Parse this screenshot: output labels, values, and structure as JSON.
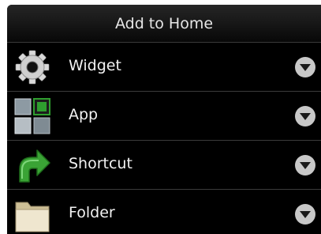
{
  "dialog": {
    "title": "Add to Home",
    "items": [
      {
        "label": "Widget",
        "icon": "gear-icon",
        "arrow": "chevron-down-icon"
      },
      {
        "label": "App",
        "icon": "app-grid-icon",
        "arrow": "chevron-down-icon"
      },
      {
        "label": "Shortcut",
        "icon": "shortcut-arrow-icon",
        "arrow": "chevron-down-icon"
      },
      {
        "label": "Folder",
        "icon": "folder-icon",
        "arrow": "chevron-down-icon"
      }
    ]
  },
  "colors": {
    "background": "#000000",
    "text": "#f2f2f2",
    "divider": "#3b3b3b",
    "shortcut_green": "#3aa335",
    "app_green": "#2f9e2f"
  }
}
